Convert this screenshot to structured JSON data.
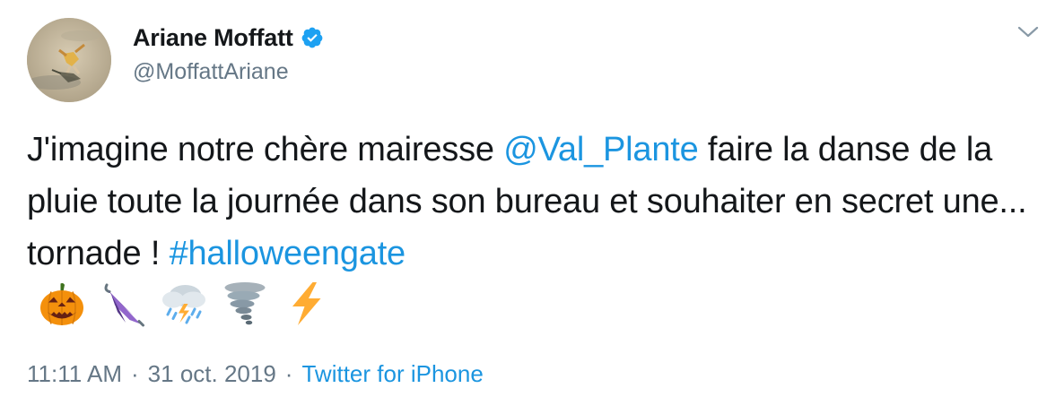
{
  "author": {
    "display_name": "Ariane Moffatt",
    "handle": "@MoffattAriane",
    "verified": true
  },
  "tweet": {
    "text_1": "J'imagine notre chère mairesse ",
    "mention": "@Val_Plante",
    "text_2": " faire la danse de la pluie toute la journée dans son bureau et souhaiter en secret une... tornade ! ",
    "hashtag": "#halloweengate",
    "emojis": [
      "jack-o-lantern",
      "closed-umbrella",
      "cloud-with-rain-lightning",
      "tornado",
      "high-voltage"
    ]
  },
  "meta": {
    "time": "11:11 AM",
    "separator": "·",
    "date": "31 oct. 2019",
    "source": "Twitter for iPhone"
  },
  "colors": {
    "link": "#1b95e0",
    "secondary": "#657786",
    "text": "#14171a",
    "verified": "#1da1f2"
  }
}
